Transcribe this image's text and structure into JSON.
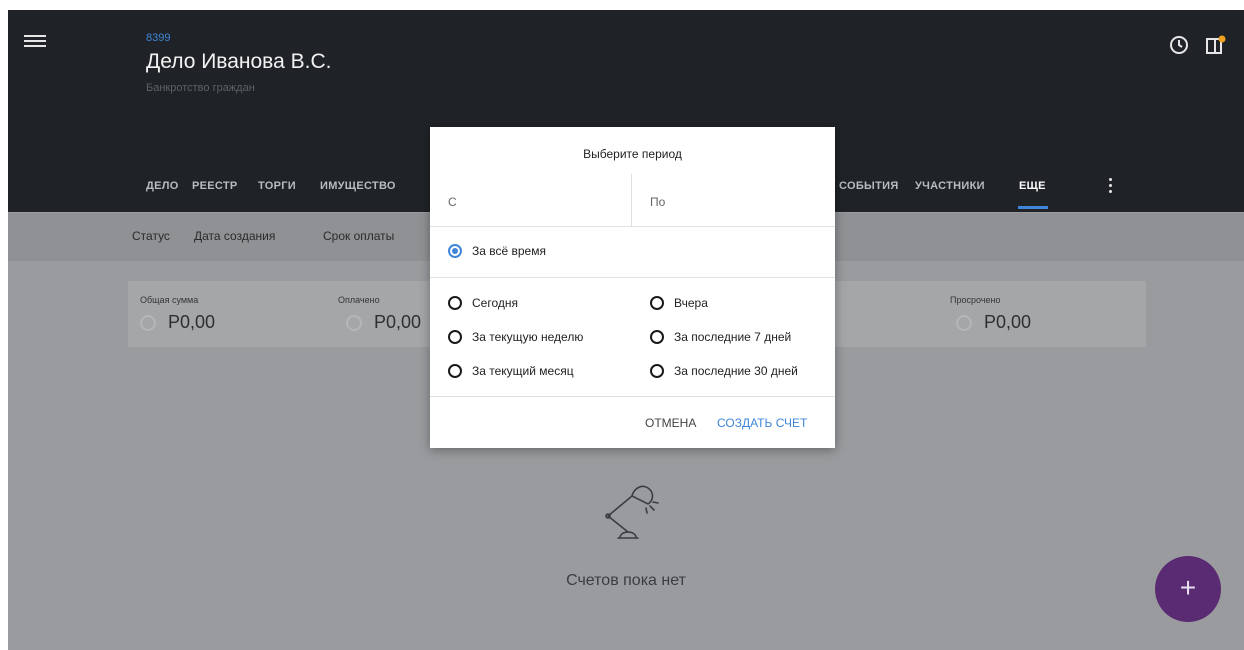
{
  "header": {
    "case_number": "8399",
    "case_title": "Дело Иванова В.С.",
    "case_subtitle": "Банкротство граждан",
    "tabs": [
      {
        "label": "ДЕЛО"
      },
      {
        "label": "РЕЕСТР"
      },
      {
        "label": "ТОРГИ"
      },
      {
        "label": "ИМУЩЕСТВО"
      },
      {
        "label": "СОБЫТИЯ"
      },
      {
        "label": "УЧАСТНИКИ"
      },
      {
        "label": "ЕЩЕ"
      }
    ],
    "active_tab": "ЕЩЕ",
    "icons": [
      "menu-icon",
      "clock-icon",
      "panel-icon",
      "more-vert-icon"
    ],
    "notification_color": "#f0a020"
  },
  "filters": [
    "Статус",
    "Дата создания",
    "Срок оплаты"
  ],
  "summary": [
    {
      "label": "Общая сумма",
      "value": "Р0,00"
    },
    {
      "label": "Оплачено",
      "value": "Р0,00"
    },
    {
      "label": "Просрочено",
      "value": "Р0,00"
    }
  ],
  "empty_state": {
    "text": "Счетов пока нет",
    "icon": "desk-lamp-icon"
  },
  "fab": {
    "label": "+"
  },
  "dialog": {
    "title": "Выберите период",
    "from_placeholder": "С",
    "to_placeholder": "По",
    "all_time": "За всё время",
    "options_left": [
      "Сегодня",
      "За текущую неделю",
      "За текущий месяц"
    ],
    "options_right": [
      "Вчера",
      "За последние 7 дней",
      "За последние 30 дней"
    ],
    "selected": "За всё время",
    "cancel_label": "ОТМЕНА",
    "create_label": "СОЗДАТЬ СЧЕТ"
  },
  "colors": {
    "accent": "#3f86d8",
    "header_bg": "#1f2327",
    "fab_bg": "#5a2a73"
  }
}
